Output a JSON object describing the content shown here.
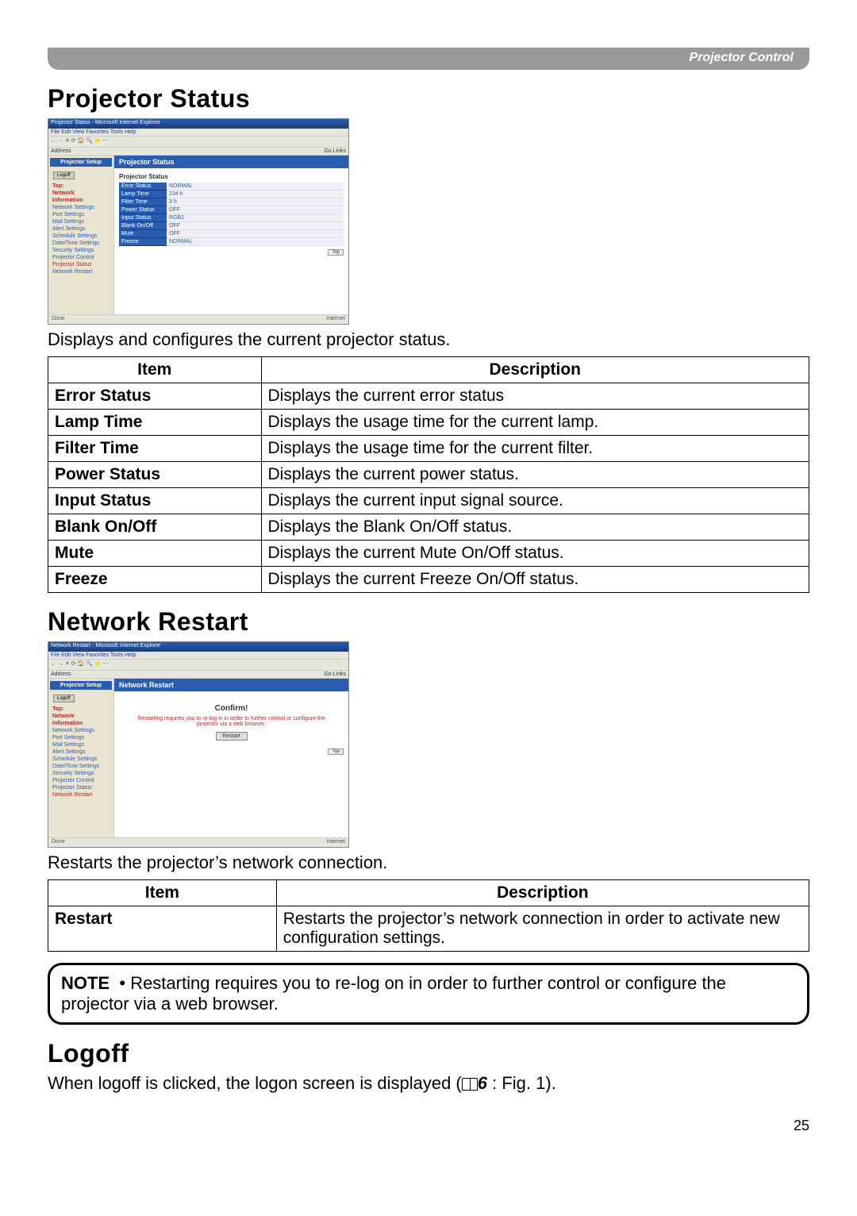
{
  "topbar": {
    "label": "Projector Control"
  },
  "section1": {
    "title": "Projector Status",
    "intro": "Displays and configures the current projector status."
  },
  "screenshot1": {
    "window_title": "Projector Status - Microsoft Internet Explorer",
    "menu": "File  Edit  View  Favorites  Tools  Help",
    "sidebar_title": "Projector Setup",
    "logoff": "Logoff",
    "nav_heads": [
      "Top:",
      "Network",
      "Information"
    ],
    "nav_items": [
      "Network Settings",
      "Port Settings",
      "Mail Settings",
      "Alert Settings",
      "Schedule Settings",
      "Date/Time Settings",
      "Security Settings",
      "Projector Control",
      "Projector Status",
      "Network Restart"
    ],
    "active_item": "Projector Status",
    "main_title": "Projector Status",
    "subtitle": "Projector Status",
    "rows": [
      {
        "k": "Error Status",
        "v": "NORMAL"
      },
      {
        "k": "Lamp Time",
        "v": "234 h"
      },
      {
        "k": "Filter Time",
        "v": "3 h"
      },
      {
        "k": "Power Status",
        "v": "OFF"
      },
      {
        "k": "Input Status",
        "v": "RGB2"
      },
      {
        "k": "Blank On/Off",
        "v": "OFF"
      },
      {
        "k": "Mute",
        "v": "OFF"
      },
      {
        "k": "Freeze",
        "v": "NORMAL"
      }
    ],
    "top_btn": "Top",
    "footer_left": "Done",
    "footer_right": "Internet"
  },
  "table1": {
    "headers": {
      "item": "Item",
      "desc": "Description"
    },
    "rows": [
      {
        "item": "Error Status",
        "desc": "Displays the current error status"
      },
      {
        "item": "Lamp Time",
        "desc": "Displays the usage time for the current lamp."
      },
      {
        "item": "Filter Time",
        "desc": "Displays the usage time for the current filter."
      },
      {
        "item": "Power Status",
        "desc": "Displays the current power status."
      },
      {
        "item": "Input Status",
        "desc": "Displays the current input signal source."
      },
      {
        "item": "Blank On/Off",
        "desc": "Displays the Blank On/Off status."
      },
      {
        "item": "Mute",
        "desc": "Displays the current Mute On/Off status."
      },
      {
        "item": "Freeze",
        "desc": "Displays the current Freeze On/Off status."
      }
    ]
  },
  "section2": {
    "title": "Network Restart",
    "intro": "Restarts the projector’s network connection."
  },
  "screenshot2": {
    "window_title": "Network Restart - Microsoft Internet Explorer",
    "menu": "File  Edit  View  Favorites  Tools  Help",
    "sidebar_title": "Projector Setup",
    "logoff": "Logoff",
    "nav_heads": [
      "Top:",
      "Network",
      "Information"
    ],
    "nav_items": [
      "Network Settings",
      "Port Settings",
      "Mail Settings",
      "Alert Settings",
      "Schedule Settings",
      "Date/Time Settings",
      "Security Settings",
      "Projector Control",
      "Projector Status",
      "Network Restart"
    ],
    "active_item": "Network Restart",
    "main_title": "Network Restart",
    "confirm": "Confirm!",
    "confirm_msg": "Restarting requires you to re-log in in order to further control or configure the projector via a web browser.",
    "restart_btn": "Restart",
    "top_btn": "Top",
    "footer_left": "Done",
    "footer_right": "Internet"
  },
  "table2": {
    "headers": {
      "item": "Item",
      "desc": "Description"
    },
    "rows": [
      {
        "item": "Restart",
        "desc": "Restarts the projector’s network connection in order to activate new configuration settings."
      }
    ]
  },
  "note": {
    "label": "NOTE",
    "bullet": "•",
    "text": "Restarting requires you to re-log on in order to further control or configure the projector via a web browser."
  },
  "section3": {
    "title": "Logoff",
    "text_before": "When logoff is clicked, the logon screen is displayed (",
    "page_ref": "6",
    "text_after": " : Fig. 1)."
  },
  "page_number": "25"
}
